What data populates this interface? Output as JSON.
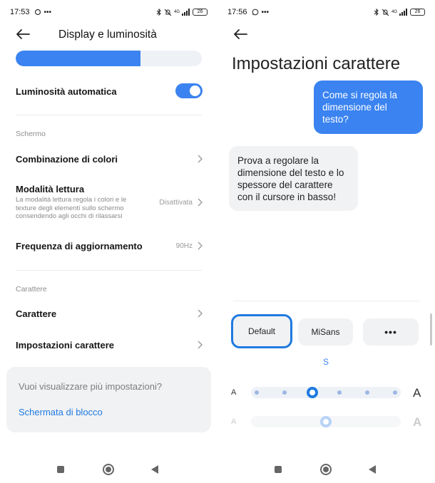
{
  "left": {
    "status": {
      "time": "17:53",
      "icons_left": [
        "notification-icon",
        "more-dots"
      ],
      "network": "4G",
      "battery": "26"
    },
    "header": {
      "title": "Display e luminosità"
    },
    "brightness": {
      "level_fraction": 0.67
    },
    "auto_brightness": {
      "label": "Luminosità automatica",
      "enabled": true
    },
    "schermo": {
      "section_label": "Schermo",
      "color_scheme": "Combinazione di colori",
      "reading_mode": {
        "label": "Modalità lettura",
        "description": "La modalità lettura regola i colori e le texture degli elementi sullo schermo consendendo agli occhi di rilassarsi",
        "value": "Disattivata"
      },
      "refresh_rate": {
        "label": "Frequenza di aggiornamento",
        "value": "90Hz"
      }
    },
    "carattere": {
      "section_label": "Carattere",
      "font": "Carattere",
      "font_settings": "Impostazioni carattere"
    },
    "more_settings": {
      "question": "Vuoi visualizzare più impostazioni?",
      "link": "Schermata di blocco"
    }
  },
  "right": {
    "status": {
      "time": "17:56",
      "icons_left": [
        "whatsapp-icon",
        "more-dots"
      ],
      "network": "4G",
      "battery": "26"
    },
    "title": "Impostazioni carattere",
    "chat": {
      "question": "Come si regola la dimensione del testo?",
      "answer": "Prova a regolare la dimensione del testo e lo spessore del carattere con il cursore in basso!"
    },
    "fonts": {
      "default": "Default",
      "misans": "MiSans",
      "more": "•••"
    },
    "size_marker": "S",
    "size_slider": {
      "small_label": "A",
      "large_label": "A",
      "stops": 6,
      "selected_index": 2
    },
    "weight_slider": {
      "small_label": "A",
      "large_label": "A",
      "position_fraction": 0.5
    }
  },
  "colors": {
    "accent": "#3a83f0",
    "link": "#1f7ae0",
    "card_bg": "#f1f2f4",
    "track_bg": "#eef1f6"
  }
}
